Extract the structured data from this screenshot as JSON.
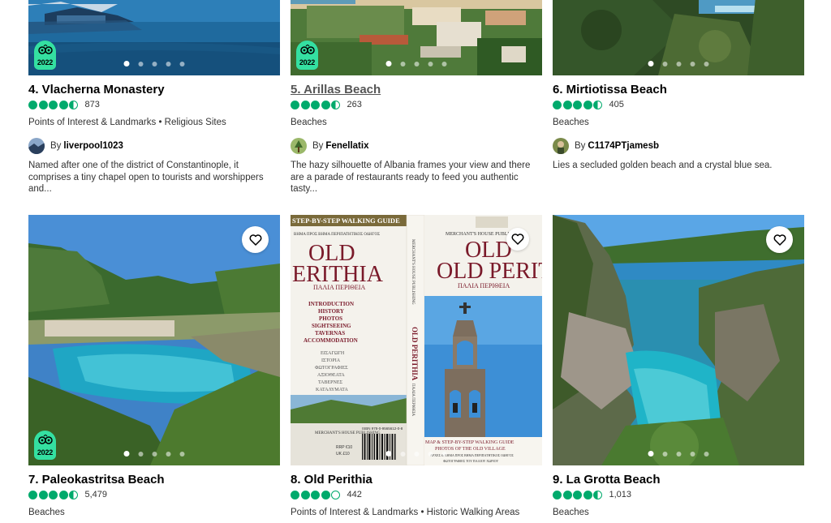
{
  "colors": {
    "rating_green": "#00aa6c",
    "badge_green": "#34e0a1"
  },
  "badge_year": "2022",
  "by_prefix": "By",
  "cards": [
    {
      "title": "4. Vlacherna Monastery",
      "rating": 4.5,
      "reviews": "873",
      "category": "Points of Interest & Landmarks • Religious Sites",
      "author": "liverpool1023",
      "description": "Named after one of the district of Constantinople, it comprises a tiny chapel open to tourists and worshippers and...",
      "badge": true,
      "icon": "none"
    },
    {
      "title": "5. Arillas Beach",
      "rating": 4.5,
      "reviews": "263",
      "category": "Beaches",
      "author": "Fenellatix",
      "description": "The hazy silhouette of Albania frames your view and there are a parade of restaurants ready to feed you authentic tasty...",
      "badge": true,
      "icon": "none"
    },
    {
      "title": "6. Mirtiotissa Beach",
      "rating": 4.5,
      "reviews": "405",
      "category": "Beaches",
      "author": "C1174PTjamesb",
      "description": "Lies a secluded golden beach and a crystal blue sea.",
      "badge": false,
      "icon": "none"
    },
    {
      "title": "7. Paleokastritsa Beach",
      "rating": 4.5,
      "reviews": "5,479",
      "category": "Beaches",
      "badge": true,
      "icon": "heart-icon"
    },
    {
      "title": "8. Old Perithia",
      "rating": 4.0,
      "reviews": "442",
      "category": "Points of Interest & Landmarks • Historic Walking Areas",
      "badge": false,
      "icon": "heart-icon"
    },
    {
      "title": "9. La Grotta Beach",
      "rating": 4.5,
      "reviews": "1,013",
      "category": "Beaches",
      "badge": false,
      "icon": "heart-icon"
    }
  ],
  "book_cover": {
    "banner": "STEP-BY-STEP WALKING GUIDE",
    "greek_banner": "ΒΗΜΑ ΠΡΟΣ ΒΗΜΑ ΠΕΡΙΠΑΤΗΤΙΚΟΣ ΟΔΗΓΟΣ",
    "title_line1": "OLD",
    "title_line2": "ERITHIA",
    "greek_title": "ΠΑΛΙΑ ΠΕΡΙΘΕΙΑ",
    "contents": [
      "INTRODUCTION",
      "HISTORY",
      "PHOTOS",
      "SIGHTSEEING",
      "TAVERNAS",
      "ACCOMMODATION"
    ],
    "greek_contents": [
      "ΕΙΣΑΓΩΓΗ",
      "ΙΣΤΟΡΙΑ",
      "ΦΩΤΟΓΡΑΦΙΕΣ",
      "ΑΞΙΟΘΕΑΤΑ",
      "ΤΑΒΕΡΝΕΣ",
      "ΚΑΤΑΛΥΜΑΤΑ"
    ],
    "spine_publisher": "MERCHANT'S HOUSE PUBLISHING",
    "spine_title": "OLD PERITHIA",
    "spine_greek": "ΠΑΛΙΑ ΠΕΡΙΘΕΙΑ",
    "back_publisher": "MERCHANT'S HOUSE PUBLISHING",
    "back_title": "OLD PERITHIA",
    "back_greek": "ΠΑΛΙΑ ΠΕΡΙΘΕΙΑ",
    "back_footer1": "MAP & STEP-BY-STEP WALKING GUIDE",
    "back_footer2": "PHOTOS OF THE OLD VILLAGE",
    "back_footer3": "ΑΡΧΕΣ & ΒΗΜΑ ΠΡΟΣ ΒΗΜΑ ΠΕΡΙΠΑΤΗΤΙΚΟΣ ΟΔΗΓΟΣ",
    "back_footer4": "ΦΩΤΟΓΡΑΦΙΕΣ ΤΟΥ ΠΑΛΙΟΥ ΧΩΡΙΟΥ",
    "publisher_small": "MERCHANT'S HOUSE PUBLISHING",
    "isbn": "ISBN 978-0-9565612-0-8",
    "price1": "RRP €10",
    "price2": "UK £10"
  }
}
